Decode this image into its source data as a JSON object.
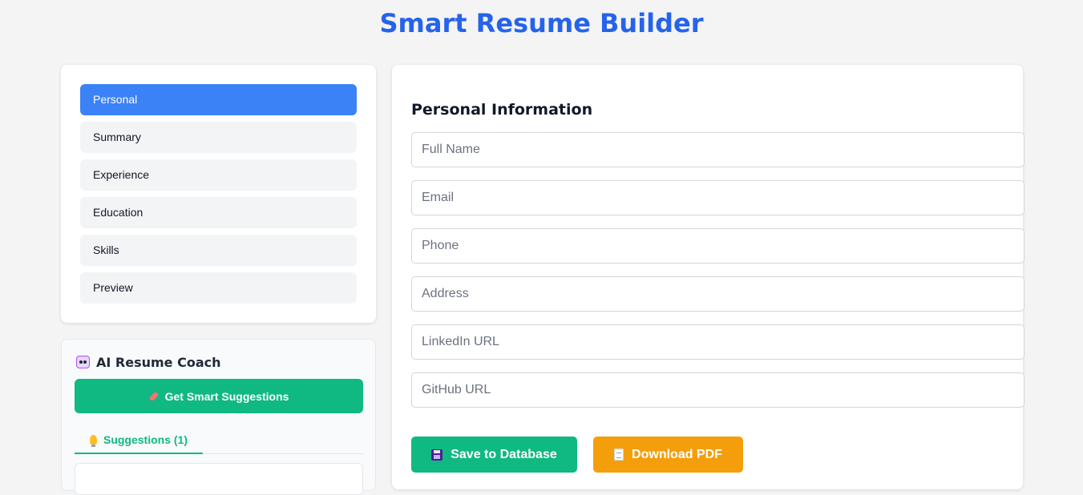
{
  "app": {
    "title": "Smart Resume Builder",
    "accent": "#2563eb"
  },
  "sidebar": {
    "items": [
      {
        "label": "Personal",
        "active": true
      },
      {
        "label": "Summary",
        "active": false
      },
      {
        "label": "Experience",
        "active": false
      },
      {
        "label": "Education",
        "active": false
      },
      {
        "label": "Skills",
        "active": false
      },
      {
        "label": "Preview",
        "active": false
      }
    ]
  },
  "coach": {
    "title": "AI Resume Coach",
    "title_icon": "robot-icon",
    "button_label": "Get Smart Suggestions",
    "button_icon": "pill-icon",
    "tab_label": "Suggestions (1)",
    "tab_icon": "bulb-icon"
  },
  "form": {
    "title": "Personal Information",
    "fields": [
      {
        "placeholder": "Full Name",
        "value": ""
      },
      {
        "placeholder": "Email",
        "value": ""
      },
      {
        "placeholder": "Phone",
        "value": ""
      },
      {
        "placeholder": "Address",
        "value": ""
      },
      {
        "placeholder": "LinkedIn URL",
        "value": ""
      },
      {
        "placeholder": "GitHub URL",
        "value": ""
      }
    ],
    "save_label": "Save to Database",
    "save_icon": "floppy-disk-icon",
    "pdf_label": "Download PDF",
    "pdf_icon": "document-icon"
  }
}
